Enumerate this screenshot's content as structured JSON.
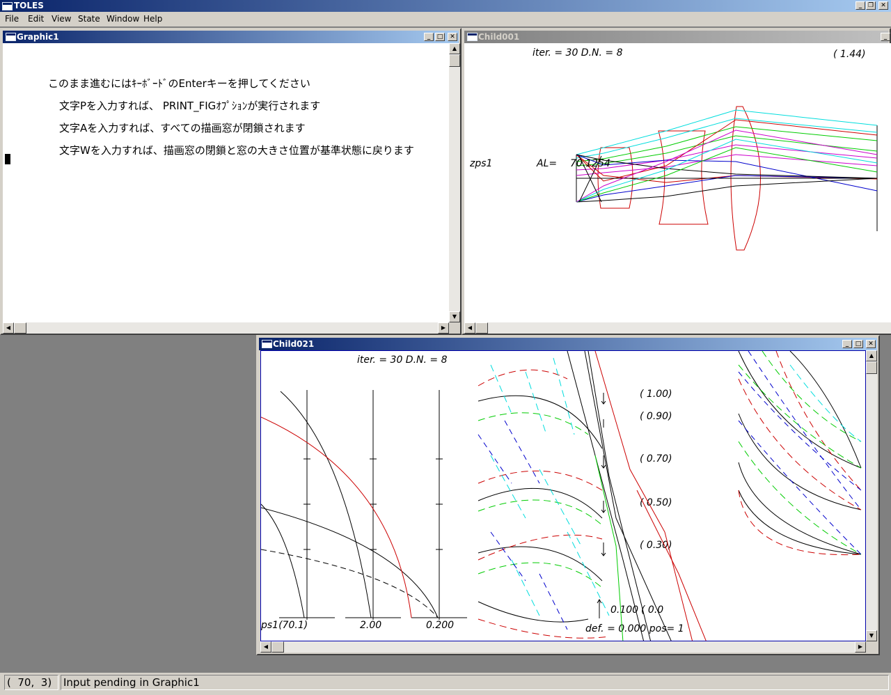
{
  "app": {
    "title": "TOLES"
  },
  "menu": [
    "File",
    "Edit",
    "View",
    "State",
    "Window",
    "Help"
  ],
  "graphic1": {
    "title": "Graphic1",
    "lines": [
      "このまま進むにはｷｰﾎﾞｰﾄﾞのEnterキーを押してください",
      "文字Pを入力すれば、 PRINT_FIGｵﾌﾟｼｮﾝが実行されます",
      "文字Aを入力すれば、すべての描画窓が閉鎖されます",
      "文字Wを入力すれば、描画窓の閉鎖と窓の大きさ位置が基準状態に戻ります"
    ]
  },
  "child001": {
    "title": "Child001",
    "iter_text": "iter. =   30 D.N. =    8",
    "corner_text": "(    1.44)",
    "zps_label": "zps1",
    "al_label": "AL=",
    "al_value": "70.1254"
  },
  "child021": {
    "title": "Child021",
    "iter_text": "iter. =   30 D.N. =    8",
    "axis_labels": [
      "ps1(70.1)",
      "2.00",
      "0.200"
    ],
    "field_labels": [
      "( 1.00)",
      "( 0.90)",
      "( 0.70)",
      "( 0.50)",
      "( 0.30)"
    ],
    "scale_label": "0.100",
    "scale_label2": "( 0.0",
    "def_text": "def. =    0.000 pos= 1"
  },
  "status": {
    "coords": "(  70,  3)",
    "message": "Input pending in Graphic1"
  },
  "colors": {
    "ray_red": "#cc0000",
    "ray_green": "#00cc00",
    "ray_cyan": "#00dddd",
    "ray_blue": "#0000cc",
    "ray_magenta": "#cc00cc"
  }
}
